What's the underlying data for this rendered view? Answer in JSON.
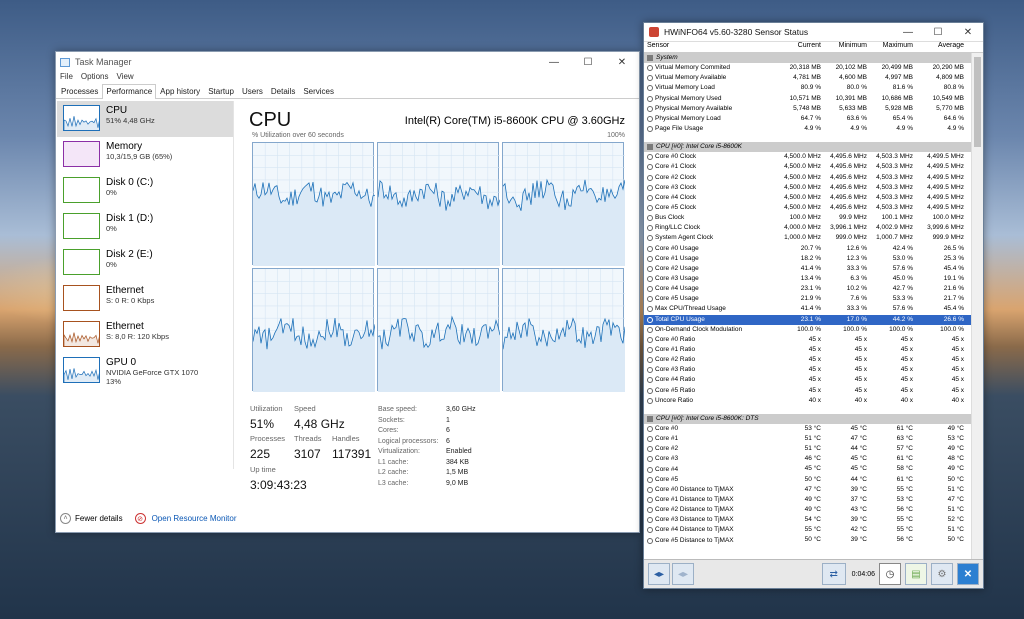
{
  "task_manager": {
    "title": "Task Manager",
    "window_controls": [
      "—",
      "☐",
      "✕"
    ],
    "menu": [
      "File",
      "Options",
      "View"
    ],
    "tabs": [
      "Processes",
      "Performance",
      "App history",
      "Startup",
      "Users",
      "Details",
      "Services"
    ],
    "sidebar": [
      {
        "title": "CPU",
        "sub1": "51% 4,48 GHz",
        "sub2": "",
        "color": "#1e6fb8"
      },
      {
        "title": "Memory",
        "sub1": "10,3/15,9 GB (65%)",
        "sub2": "",
        "color": "#8b2fa6"
      },
      {
        "title": "Disk 0 (C:)",
        "sub1": "0%",
        "sub2": "",
        "color": "#4aa02c"
      },
      {
        "title": "Disk 1 (D:)",
        "sub1": "0%",
        "sub2": "",
        "color": "#4aa02c"
      },
      {
        "title": "Disk 2 (E:)",
        "sub1": "0%",
        "sub2": "",
        "color": "#4aa02c"
      },
      {
        "title": "Ethernet",
        "sub1": "S: 0 R: 0 Kbps",
        "sub2": "",
        "color": "#a7521f"
      },
      {
        "title": "Ethernet",
        "sub1": "S: 8,0 R: 120 Kbps",
        "sub2": "",
        "color": "#a7521f"
      },
      {
        "title": "GPU 0",
        "sub1": "NVIDIA GeForce GTX 1070",
        "sub2": "13%",
        "color": "#1e6fb8"
      }
    ],
    "main": {
      "heading": "CPU",
      "model": "Intel(R) Core(TM) i5-8600K CPU @ 3.60GHz",
      "util_label": "% Utilization over 60 seconds",
      "util_max": "100%",
      "stats": {
        "utilization_label": "Utilization",
        "utilization": "51%",
        "speed_label": "Speed",
        "speed": "4,48 GHz",
        "processes_label": "Processes",
        "processes": "225",
        "threads_label": "Threads",
        "threads": "3107",
        "handles_label": "Handles",
        "handles": "117391",
        "uptime_label": "Up time",
        "uptime": "3:09:43:23"
      },
      "specs": [
        [
          "Base speed:",
          "3,60 GHz"
        ],
        [
          "Sockets:",
          "1"
        ],
        [
          "Cores:",
          "6"
        ],
        [
          "Logical processors:",
          "6"
        ],
        [
          "Virtualization:",
          "Enabled"
        ],
        [
          "L1 cache:",
          "384 KB"
        ],
        [
          "L2 cache:",
          "1,5 MB"
        ],
        [
          "L3 cache:",
          "9,0 MB"
        ]
      ]
    },
    "footer": {
      "fewer": "Fewer details",
      "monitor": "Open Resource Monitor"
    }
  },
  "hwinfo": {
    "title": "HWiNFO64 v5.60-3280 Sensor Status",
    "window_controls": [
      "—",
      "☐",
      "✕"
    ],
    "columns": [
      "Sensor",
      "Current",
      "Minimum",
      "Maximum",
      "Average"
    ],
    "rows": [
      {
        "t": "g",
        "n": "System"
      },
      {
        "n": "Virtual Memory Commited",
        "c": "20,318 MB",
        "mi": "20,102 MB",
        "ma": "20,499 MB",
        "av": "20,290 MB"
      },
      {
        "n": "Virtual Memory Available",
        "c": "4,781 MB",
        "mi": "4,600 MB",
        "ma": "4,997 MB",
        "av": "4,809 MB"
      },
      {
        "n": "Virtual Memory Load",
        "c": "80.9 %",
        "mi": "80.0 %",
        "ma": "81.6 %",
        "av": "80.8 %"
      },
      {
        "n": "Physical Memory Used",
        "c": "10,571 MB",
        "mi": "10,391 MB",
        "ma": "10,686 MB",
        "av": "10,549 MB"
      },
      {
        "n": "Physical Memory Available",
        "c": "5,748 MB",
        "mi": "5,633 MB",
        "ma": "5,928 MB",
        "av": "5,770 MB"
      },
      {
        "n": "Physical Memory Load",
        "c": "64.7 %",
        "mi": "63.6 %",
        "ma": "65.4 %",
        "av": "64.6 %"
      },
      {
        "n": "Page File Usage",
        "c": "4.9 %",
        "mi": "4.9 %",
        "ma": "4.9 %",
        "av": "4.9 %"
      },
      {
        "t": "b"
      },
      {
        "t": "g",
        "n": "CPU [#0]: Intel Core i5-8600K"
      },
      {
        "n": "Core #0 Clock",
        "c": "4,500.0 MHz",
        "mi": "4,495.6 MHz",
        "ma": "4,503.3 MHz",
        "av": "4,499.5 MHz"
      },
      {
        "n": "Core #1 Clock",
        "c": "4,500.0 MHz",
        "mi": "4,495.6 MHz",
        "ma": "4,503.3 MHz",
        "av": "4,499.5 MHz"
      },
      {
        "n": "Core #2 Clock",
        "c": "4,500.0 MHz",
        "mi": "4,495.6 MHz",
        "ma": "4,503.3 MHz",
        "av": "4,499.5 MHz"
      },
      {
        "n": "Core #3 Clock",
        "c": "4,500.0 MHz",
        "mi": "4,495.6 MHz",
        "ma": "4,503.3 MHz",
        "av": "4,499.5 MHz"
      },
      {
        "n": "Core #4 Clock",
        "c": "4,500.0 MHz",
        "mi": "4,495.6 MHz",
        "ma": "4,503.3 MHz",
        "av": "4,499.5 MHz"
      },
      {
        "n": "Core #5 Clock",
        "c": "4,500.0 MHz",
        "mi": "4,495.6 MHz",
        "ma": "4,503.3 MHz",
        "av": "4,499.5 MHz"
      },
      {
        "n": "Bus Clock",
        "c": "100.0 MHz",
        "mi": "99.9 MHz",
        "ma": "100.1 MHz",
        "av": "100.0 MHz"
      },
      {
        "n": "Ring/LLC Clock",
        "c": "4,000.0 MHz",
        "mi": "3,996.1 MHz",
        "ma": "4,002.9 MHz",
        "av": "3,999.6 MHz"
      },
      {
        "n": "System Agent Clock",
        "c": "1,000.0 MHz",
        "mi": "999.0 MHz",
        "ma": "1,000.7 MHz",
        "av": "999.9 MHz"
      },
      {
        "n": "Core #0 Usage",
        "c": "20.7 %",
        "mi": "12.6 %",
        "ma": "42.4 %",
        "av": "26.5 %"
      },
      {
        "n": "Core #1 Usage",
        "c": "18.2 %",
        "mi": "12.3 %",
        "ma": "53.0 %",
        "av": "25.3 %"
      },
      {
        "n": "Core #2 Usage",
        "c": "41.4 %",
        "mi": "33.3 %",
        "ma": "57.6 %",
        "av": "45.4 %"
      },
      {
        "n": "Core #3 Usage",
        "c": "13.4 %",
        "mi": "6.3 %",
        "ma": "45.0 %",
        "av": "19.1 %"
      },
      {
        "n": "Core #4 Usage",
        "c": "23.1 %",
        "mi": "10.2 %",
        "ma": "42.7 %",
        "av": "21.6 %"
      },
      {
        "n": "Core #5 Usage",
        "c": "21.9 %",
        "mi": "7.6 %",
        "ma": "53.3 %",
        "av": "21.7 %"
      },
      {
        "n": "Max CPU/Thread Usage",
        "c": "41.4 %",
        "mi": "33.3 %",
        "ma": "57.6 %",
        "av": "45.4 %"
      },
      {
        "n": "Total CPU Usage",
        "c": "23.1 %",
        "mi": "17.0 %",
        "ma": "44.2 %",
        "av": "26.6 %",
        "hl": true
      },
      {
        "n": "On-Demand Clock Modulation",
        "c": "100.0 %",
        "mi": "100.0 %",
        "ma": "100.0 %",
        "av": "100.0 %"
      },
      {
        "n": "Core #0 Ratio",
        "c": "45 x",
        "mi": "45 x",
        "ma": "45 x",
        "av": "45 x"
      },
      {
        "n": "Core #1 Ratio",
        "c": "45 x",
        "mi": "45 x",
        "ma": "45 x",
        "av": "45 x"
      },
      {
        "n": "Core #2 Ratio",
        "c": "45 x",
        "mi": "45 x",
        "ma": "45 x",
        "av": "45 x"
      },
      {
        "n": "Core #3 Ratio",
        "c": "45 x",
        "mi": "45 x",
        "ma": "45 x",
        "av": "45 x"
      },
      {
        "n": "Core #4 Ratio",
        "c": "45 x",
        "mi": "45 x",
        "ma": "45 x",
        "av": "45 x"
      },
      {
        "n": "Core #5 Ratio",
        "c": "45 x",
        "mi": "45 x",
        "ma": "45 x",
        "av": "45 x"
      },
      {
        "n": "Uncore Ratio",
        "c": "40 x",
        "mi": "40 x",
        "ma": "40 x",
        "av": "40 x"
      },
      {
        "t": "b"
      },
      {
        "t": "g",
        "n": "CPU [#0]: Intel Core i5-8600K: DTS"
      },
      {
        "n": "Core #0",
        "c": "53 °C",
        "mi": "45 °C",
        "ma": "61 °C",
        "av": "49 °C"
      },
      {
        "n": "Core #1",
        "c": "51 °C",
        "mi": "47 °C",
        "ma": "63 °C",
        "av": "53 °C"
      },
      {
        "n": "Core #2",
        "c": "51 °C",
        "mi": "44 °C",
        "ma": "57 °C",
        "av": "49 °C"
      },
      {
        "n": "Core #3",
        "c": "46 °C",
        "mi": "45 °C",
        "ma": "61 °C",
        "av": "48 °C"
      },
      {
        "n": "Core #4",
        "c": "45 °C",
        "mi": "45 °C",
        "ma": "58 °C",
        "av": "49 °C"
      },
      {
        "n": "Core #5",
        "c": "50 °C",
        "mi": "44 °C",
        "ma": "61 °C",
        "av": "50 °C"
      },
      {
        "n": "Core #0 Distance to TjMAX",
        "c": "47 °C",
        "mi": "39 °C",
        "ma": "55 °C",
        "av": "51 °C"
      },
      {
        "n": "Core #1 Distance to TjMAX",
        "c": "49 °C",
        "mi": "37 °C",
        "ma": "53 °C",
        "av": "47 °C"
      },
      {
        "n": "Core #2 Distance to TjMAX",
        "c": "49 °C",
        "mi": "43 °C",
        "ma": "56 °C",
        "av": "51 °C"
      },
      {
        "n": "Core #3 Distance to TjMAX",
        "c": "54 °C",
        "mi": "39 °C",
        "ma": "55 °C",
        "av": "52 °C"
      },
      {
        "n": "Core #4 Distance to TjMAX",
        "c": "55 °C",
        "mi": "42 °C",
        "ma": "55 °C",
        "av": "51 °C"
      },
      {
        "n": "Core #5 Distance to TjMAX",
        "c": "50 °C",
        "mi": "39 °C",
        "ma": "56 °C",
        "av": "50 °C"
      }
    ],
    "toolbar": {
      "timer": "0:04:06"
    }
  }
}
